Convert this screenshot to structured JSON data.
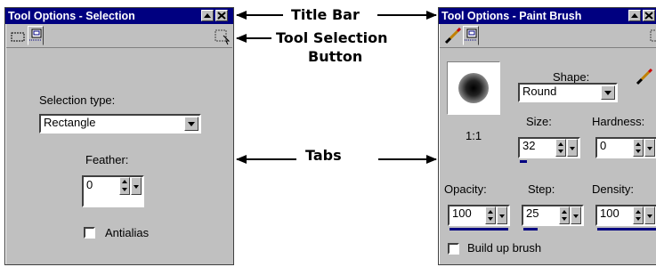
{
  "left_panel": {
    "title": "Tool Options - Selection",
    "selection_type_label": "Selection type:",
    "selection_type_value": "Rectangle",
    "feather_label": "Feather:",
    "feather_value": "0",
    "antialias_label": "Antialias",
    "antialias_checked": false
  },
  "right_panel": {
    "title": "Tool Options - Paint Brush",
    "shape_label": "Shape:",
    "shape_value": "Round",
    "ratio": "1:1",
    "size_label": "Size:",
    "size_value": "32",
    "hardness_label": "Hardness:",
    "hardness_value": "0",
    "opacity_label": "Opacity:",
    "opacity_value": "100",
    "step_label": "Step:",
    "step_value": "25",
    "density_label": "Density:",
    "density_value": "100",
    "build_up_label": "Build up brush",
    "build_up_checked": false
  },
  "annotations": {
    "title_bar": "Title Bar",
    "tool_selection_line1": "Tool Selection",
    "tool_selection_line2": "Button",
    "tabs": "Tabs"
  },
  "icons": {
    "minimize": "minimize-icon",
    "close": "close-icon",
    "marquee": "marquee-tab-icon",
    "options_tab": "options-tab-icon",
    "paintbrush": "paintbrush-icon",
    "tool_select": "tool-selection-icon"
  },
  "colors": {
    "titlebar": "#000080",
    "panel": "#c0c0c0",
    "accent_bar": "#000080"
  }
}
